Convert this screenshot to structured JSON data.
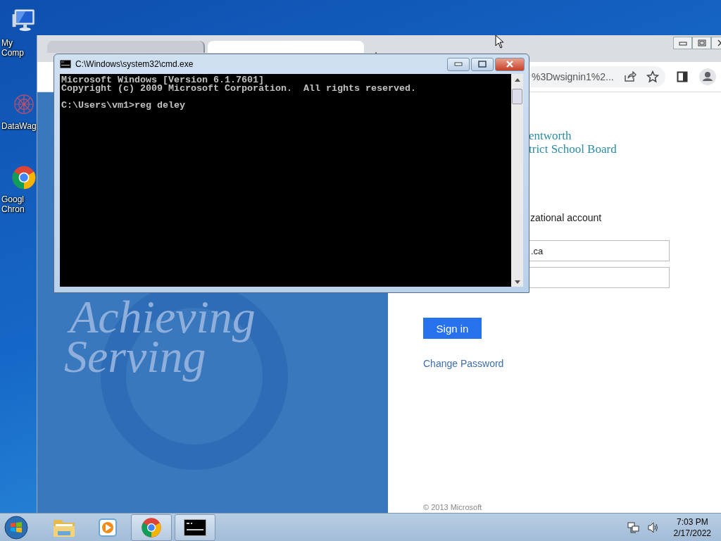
{
  "desktop_icons": [
    {
      "kind": "computer",
      "label": "My Comp"
    },
    {
      "kind": "datawag",
      "label": "DataWag"
    },
    {
      "kind": "chrome",
      "label": "Googl Chron"
    }
  ],
  "browser": {
    "tabs": [
      {
        "selected": false
      },
      {
        "selected": true
      }
    ],
    "address": "%3Dwsignin1%2...",
    "page": {
      "motto": [
        "Achieving",
        "Serving"
      ],
      "logo_lines": [
        "entworth",
        "trict School Board"
      ],
      "prompt": "zational account",
      "fields": [
        {
          "kind": "text",
          "value": ".ca"
        },
        {
          "kind": "password"
        }
      ],
      "sign_in_button": "Sign in",
      "change_password_link": "Change Password",
      "footer": "© 2013 Microsoft"
    }
  },
  "cmd": {
    "title": "C:\\Windows\\system32\\cmd.exe",
    "output": [
      "Microsoft Windows [Version 6.1.7601]",
      "Copyright (c) 2009 Microsoft Corporation.  All rights reserved."
    ],
    "prompt_line": "C:\\Users\\vm1>reg deley"
  },
  "taskbar": {
    "items": [
      {
        "kind": "explorer",
        "active": false
      },
      {
        "kind": "media",
        "active": false
      },
      {
        "kind": "chrome",
        "active": true
      },
      {
        "kind": "cmd",
        "active": true
      }
    ],
    "time": "7:03 PM",
    "date": "2/17/2022"
  }
}
